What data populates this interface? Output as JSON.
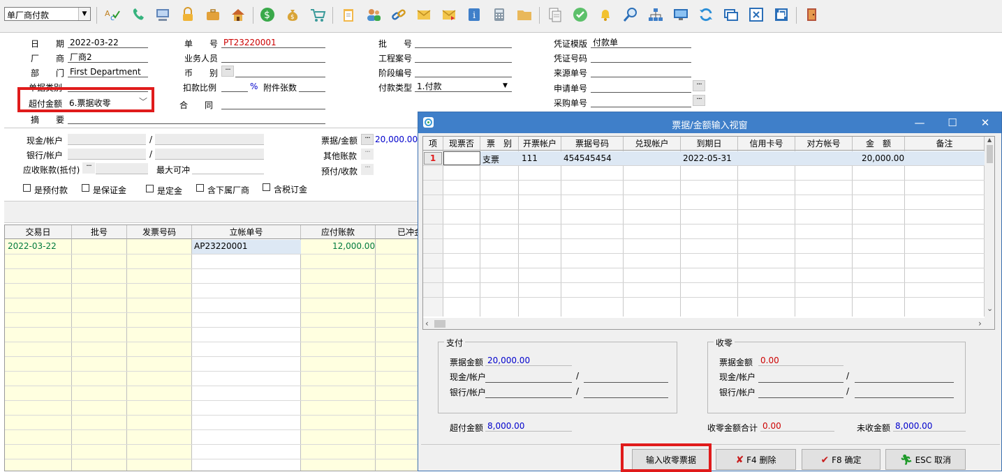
{
  "toolbar": {
    "doc_type": "单厂商付款",
    "icons": [
      "spell-check-icon",
      "phone-icon",
      "computer-icon",
      "lock-icon",
      "briefcase-icon",
      "home-icon",
      "dollar-icon",
      "money-bag-icon",
      "cart-icon",
      "clipboard-icon",
      "users-icon",
      "link-icon",
      "mail-icon",
      "info-icon",
      "calculator-icon",
      "folder-icon",
      "copy-icon",
      "check-circle-icon",
      "bell-icon",
      "search-icon",
      "org-chart-icon",
      "monitor-icon",
      "refresh-icon",
      "window-icon",
      "close-box-icon",
      "restore-icon",
      "exit-door-icon"
    ]
  },
  "form": {
    "date_label": "日　　期",
    "date": "2022-03-22",
    "vendor_label": "厂　　商",
    "vendor": "厂商2",
    "dept_label": "部　　门",
    "dept": "First Department",
    "doc_category_label": "单据类别",
    "overpay_label": "超付金额",
    "overpay_value": "6.票据收零",
    "summary_label": "摘　　要",
    "doc_no_label": "单　　号",
    "doc_no": "PT23220001",
    "salesperson_label": "业务人员",
    "currency_label": "币　　别",
    "discount_label": "扣款比例",
    "percent": "%",
    "attachments_label": "附件张数",
    "contract_label": "合　　同",
    "batch_label": "批　　号",
    "project_label": "工程案号",
    "phase_label": "阶段编号",
    "paytype_label": "付款类型",
    "paytype": "1.付款",
    "voucher_tpl_label": "凭证模版",
    "voucher_tpl": "付款单",
    "voucher_no_label": "凭证号码",
    "source_label": "来源单号",
    "apply_label": "申请单号",
    "purchase_label": "采购单号",
    "cash_label": "现金/帐户",
    "bank_label": "银行/帐户",
    "ar_label": "应收账款(抵付)",
    "max_offset_label": "最大可冲",
    "slash": "/",
    "bill_amount_label": "票据/金额",
    "bill_amount": "20,000.00",
    "other_label": "其他账款",
    "prepay_label": "预付/收款"
  },
  "checkboxes": [
    "是预付款",
    "是保证金",
    "是定金",
    "含下属厂商",
    "含税订金"
  ],
  "main_grid": {
    "headers": [
      "交易日",
      "批号",
      "发票号码",
      "立帐单号",
      "应付账款",
      "已冲金"
    ],
    "rows": [
      {
        "date": "2022-03-22",
        "batch": "",
        "invoice": "",
        "ap_no": "AP23220001",
        "payable": "12,000.00"
      }
    ]
  },
  "dialog": {
    "title": "票据/金额输入视窗",
    "headers": [
      "项",
      "现票否",
      "票　别",
      "开票帐户",
      "票据号码",
      "兑现帐户",
      "到期日",
      "信用卡号",
      "对方帐号",
      "金　额",
      "备注"
    ],
    "rows": [
      {
        "idx": "1",
        "cash": "",
        "type": "支票",
        "account": "111",
        "bill_no": "454545454",
        "redeem": "",
        "due": "2022-05-31",
        "card": "",
        "counter": "",
        "amount": "20,000.00",
        "note": ""
      }
    ],
    "pay_group": "支付",
    "change_group": "收零",
    "bill_amount_label": "票据金额",
    "pay_bill_amount": "20,000.00",
    "change_bill_amount": "0.00",
    "cash_label": "现金/帐户",
    "bank_label": "银行/帐户",
    "slash": "/",
    "overpay_label": "超付金额",
    "overpay": "8,000.00",
    "change_total_label": "收零金额合计",
    "change_total": "0.00",
    "uncollected_label": "未收金额",
    "uncollected": "8,000.00",
    "buttons": {
      "input_change": "输入收零票据",
      "delete": "F4 删除",
      "confirm": "F8 确定",
      "cancel": "ESC 取消"
    }
  }
}
